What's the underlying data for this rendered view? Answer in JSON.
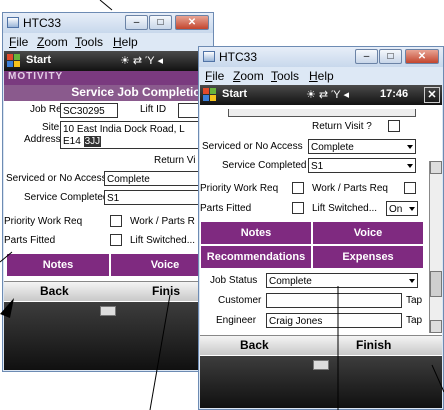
{
  "back_window": {
    "title": "HTC33",
    "menu": [
      "File",
      "Zoom",
      "Tools",
      "Help"
    ],
    "start": "Start",
    "brand": "MOTIVITY",
    "headline": "Service Job Completion",
    "job_ref_label": "Job Ref",
    "job_ref_value": "SC30295",
    "lift_id_label": "Lift ID",
    "site_address_label_1": "Site",
    "site_address_label_2": "Address",
    "site_address_line1": "10 East India Dock Road, L",
    "site_address_line2a": "E14",
    "site_address_line2b": "3JJ",
    "return_visit_label": "Return Vi",
    "serviced_label": "Serviced or No Access",
    "serviced_value": "Complete",
    "service_completed_label": "Service Completed",
    "service_completed_value": "S1",
    "priority_label": "Priority Work Req",
    "work_parts_label": "Work / Parts R",
    "parts_fitted_label": "Parts Fitted",
    "lift_switched_label": "Lift Switched...",
    "notes_btn": "Notes",
    "voice_btn": "Voice",
    "back_btn": "Back",
    "finish_btn": "Finis"
  },
  "front_window": {
    "title": "HTC33",
    "menu": [
      "File",
      "Zoom",
      "Tools",
      "Help"
    ],
    "start": "Start",
    "clock": "17:46",
    "return_visit_label": "Return Visit ?",
    "serviced_label": "Serviced or No Access",
    "serviced_value": "Complete",
    "service_completed_label": "Service Completed",
    "service_completed_value": "S1",
    "priority_label": "Priority Work Req",
    "work_parts_label": "Work / Parts Req",
    "parts_fitted_label": "Parts Fitted",
    "lift_switched_label": "Lift Switched...",
    "lift_switched_value": "On",
    "notes_btn": "Notes",
    "voice_btn": "Voice",
    "recommendations_btn": "Recommendations",
    "expenses_btn": "Expenses",
    "job_status_label": "Job Status",
    "job_status_value": "Complete",
    "customer_label": "Customer",
    "customer_value": "",
    "engineer_label": "Engineer",
    "engineer_value": "Craig Jones",
    "tap_label_1": "Tap",
    "tap_label_2": "Tap",
    "back_btn": "Back",
    "finish_btn": "Finish"
  },
  "icons": [
    "window-icon",
    "minimize-icon",
    "maximize-icon",
    "close-icon",
    "windows-flag-icon",
    "connectivity-icon",
    "signal-icon",
    "volume-icon",
    "keyboard-icon",
    "dropdown-arrow-icon",
    "scroll-up-icon",
    "scroll-down-icon"
  ],
  "colors": {
    "brand_purple": "#7f2a80",
    "titlebar": "#c8d8ec",
    "close_red": "#c3452e"
  }
}
